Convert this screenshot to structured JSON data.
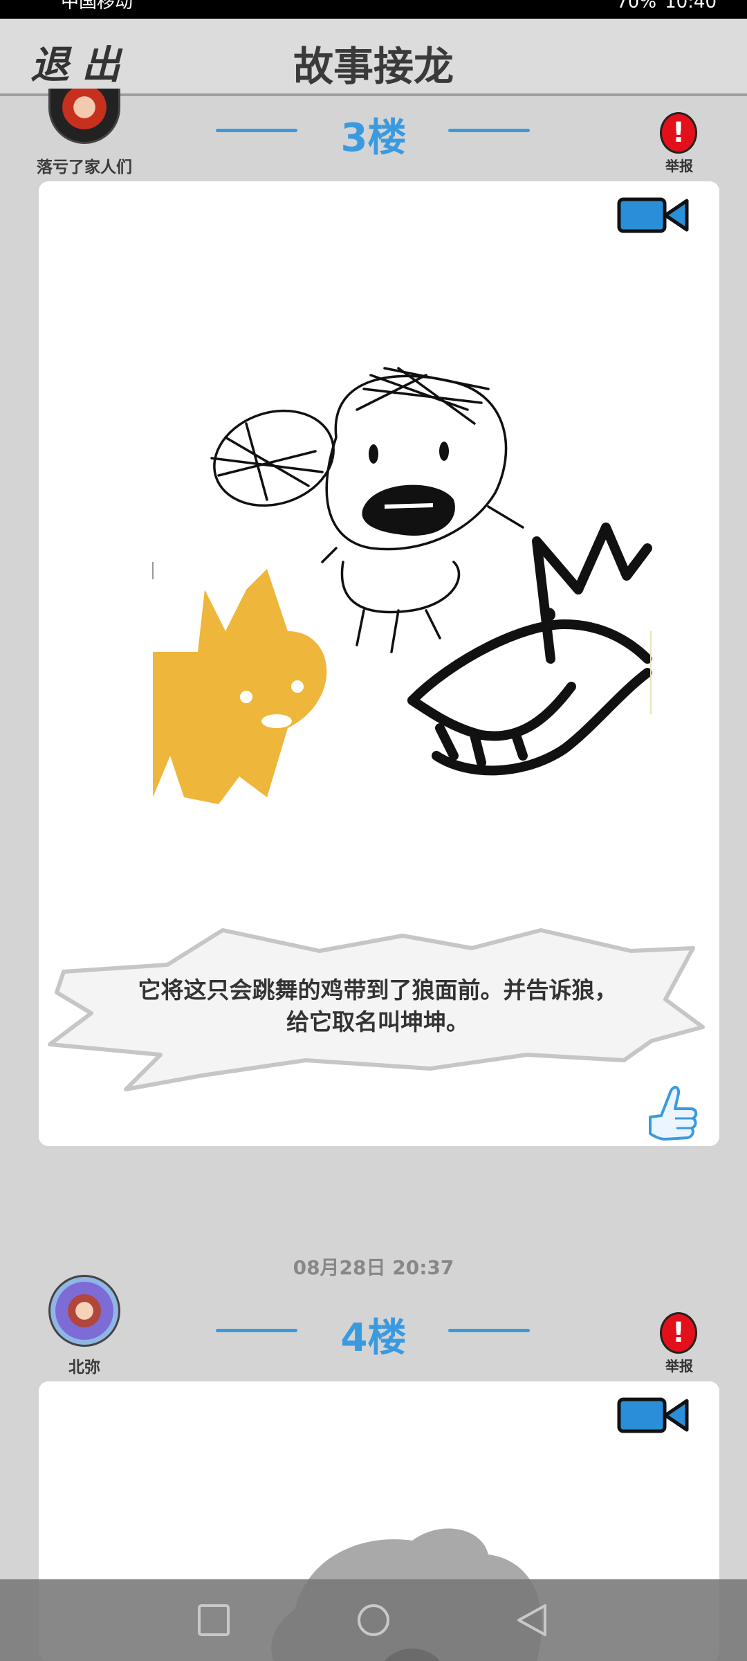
{
  "status": {
    "carrier": "中国移动",
    "battery": "70%",
    "time": "10:40"
  },
  "header": {
    "exit_label": "退出",
    "title": "故事接龙"
  },
  "floors": [
    {
      "username": "落亏了家人们",
      "floor_label": "3楼",
      "report_label": "举报",
      "caption_line1": "它将这只会跳舞的鸡带到了狼面前。并告诉狼，",
      "caption_line2": "给它取名叫坤坤。"
    },
    {
      "timestamp": "08月28日  20:37",
      "username": "北弥",
      "floor_label": "4楼",
      "report_label": "举报"
    }
  ],
  "icons": {
    "exit": "exit-text-icon",
    "report": "exclamation-icon",
    "video": "video-camera-icon",
    "like": "thumbs-up-icon",
    "nav_recent": "square-icon",
    "nav_home": "circle-icon",
    "nav_back": "triangle-back-icon"
  },
  "colors": {
    "accent": "#3a9ae0",
    "report": "#e3101b",
    "background": "#d4d4d4"
  }
}
